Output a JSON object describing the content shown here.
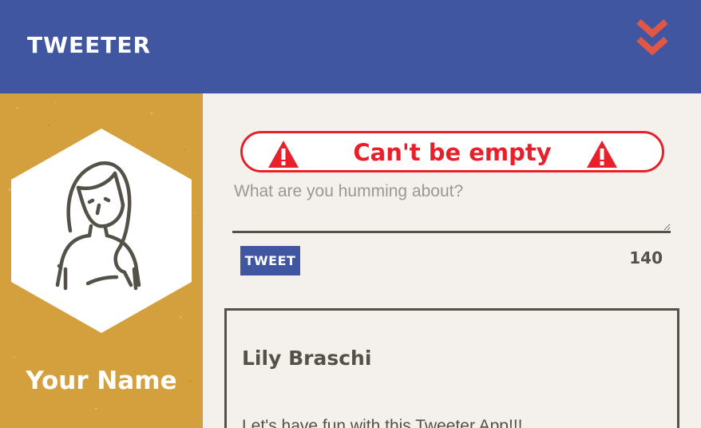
{
  "header": {
    "brand": "TWEETER",
    "toggle_icon": "double-chevron-down-icon",
    "toggle_color": "#e05845",
    "background": "#4056a1"
  },
  "profile": {
    "name": "Your Name",
    "avatar_icon": "girl-avatar-icon",
    "background": "#d4a03e"
  },
  "compose": {
    "error_message": "Can't be empty",
    "error_icon": "warning-triangle-icon",
    "error_color": "#e8202a",
    "placeholder": "What are you humming about?",
    "value": "",
    "button_label": "TWEET",
    "char_count": "140"
  },
  "feed": {
    "tweets": [
      {
        "author": "Lily Braschi",
        "text": "Let's have fun with this Tweeter App!!!"
      }
    ]
  }
}
